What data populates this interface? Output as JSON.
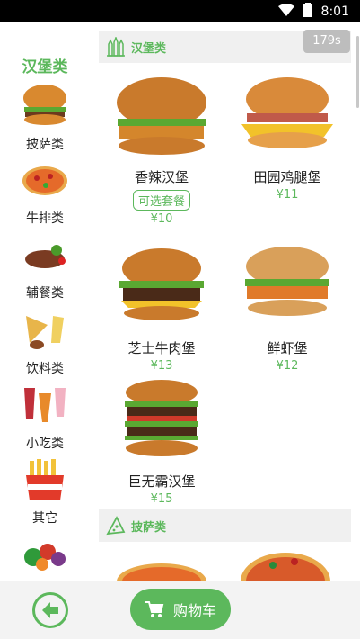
{
  "status_bar": {
    "time": "8:01"
  },
  "timer": "179s",
  "sidebar": {
    "items": [
      {
        "label": "汉堡类",
        "active": true
      },
      {
        "label": "披萨类"
      },
      {
        "label": "牛排类"
      },
      {
        "label": "辅餐类"
      },
      {
        "label": "饮料类"
      },
      {
        "label": "小吃类"
      },
      {
        "label": "其它"
      }
    ]
  },
  "sections": [
    {
      "title": "汉堡类",
      "items": [
        {
          "name": "香辣汉堡",
          "tag": "可选套餐",
          "price": "¥10"
        },
        {
          "name": "田园鸡腿堡",
          "price": "¥11"
        },
        {
          "name": "芝士牛肉堡",
          "price": "¥13"
        },
        {
          "name": "鲜虾堡",
          "price": "¥12"
        },
        {
          "name": "巨无霸汉堡",
          "price": "¥15"
        }
      ]
    },
    {
      "title": "披萨类"
    }
  ],
  "bottom_bar": {
    "cart_label": "购物车"
  },
  "colors": {
    "accent": "#5cb85c",
    "bottom_bar": "#f3f3f3"
  }
}
